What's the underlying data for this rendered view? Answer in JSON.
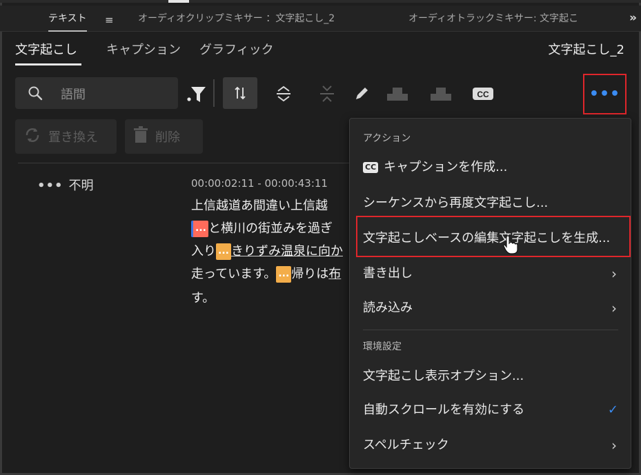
{
  "panel_tabs": {
    "tab1": "テキスト",
    "menu_icon": "≡",
    "tab2": "オーディオクリップミキサー ：文字起こし_2",
    "tab3": "オーディオトラックミキサー: 文字起こ",
    "overflow": "»"
  },
  "sub_tabs": {
    "transcript": "文字起こし",
    "captions": "キャプション",
    "graphics": "グラフィック",
    "sequence_name": "文字起こし_2"
  },
  "search": {
    "placeholder": "語間"
  },
  "toolbar": {
    "more_label": "•••",
    "cc_label": "CC"
  },
  "actions": {
    "replace_label": "置き換え",
    "delete_label": "削除"
  },
  "transcript": {
    "speaker": "不明",
    "speaker_dots": "•••",
    "timecode": "00:00:02:11 - 00:00:43:11",
    "lines": [
      "上信越道あ間違い上信越",
      "と横川の街並みを過ぎ",
      "入り",
      "きりずみ温泉に向か",
      "走っています。",
      "帰りは",
      "布",
      "す。"
    ],
    "pause_chip": "..."
  },
  "menu": {
    "section_actions": "アクション",
    "create_captions": "キャプションを作成...",
    "cc_badge": "CC",
    "retranscribe": "シーケンスから再度文字起こし...",
    "text_based_edit": "文字起こしベースの編集文字起こしを生成...",
    "export": "書き出し",
    "import": "読み込み",
    "section_prefs": "環境設定",
    "display_options": "文字起こし表示オプション...",
    "auto_scroll": "自動スクロールを有効にする",
    "spell_check": "スペルチェック",
    "arrow": "›",
    "check": "✓"
  },
  "colors": {
    "accent_blue": "#3b8cf2",
    "highlight_red": "#e0262b",
    "chip_orange": "#f3ad4a",
    "chip_red": "#ff6b5b"
  }
}
